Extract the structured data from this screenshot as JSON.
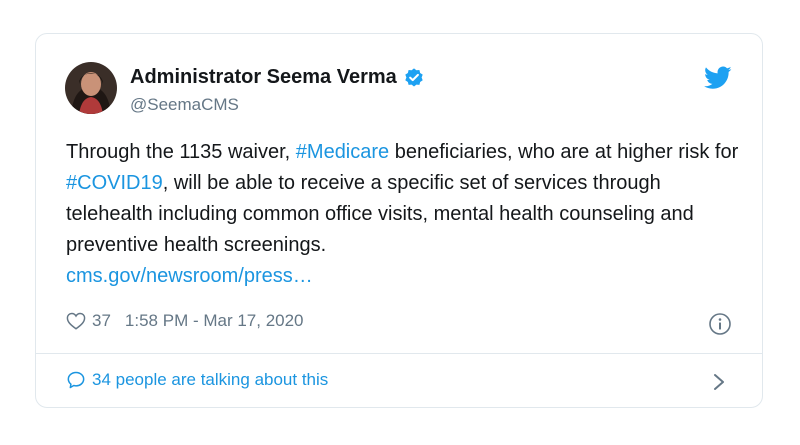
{
  "author": {
    "name": "Administrator Seema Verma",
    "handle": "@SeemaCMS"
  },
  "tweet": {
    "text_1": "Through the 1135 waiver, ",
    "hashtag_1": "#Medicare",
    "text_2": " beneficiaries, who are at higher risk for ",
    "hashtag_2": "#COVID19",
    "text_3": ", will be able to receive a specific set of services through telehealth including common office visits, mental health counseling and preventive health screenings.",
    "link": "cms.gov/newsroom/press…"
  },
  "meta": {
    "likes": "37",
    "timestamp": "1:58 PM - Mar 17, 2020"
  },
  "footer": {
    "talking": "34 people are talking about this"
  },
  "colors": {
    "accent": "#1da1f2",
    "link": "#1b95e0",
    "text": "#14171a",
    "muted": "#657786",
    "border": "#e1e8ed"
  },
  "icons": [
    "verified-badge-icon",
    "twitter-bird-icon",
    "heart-icon",
    "info-icon",
    "speech-bubble-icon",
    "chevron-right-icon"
  ]
}
